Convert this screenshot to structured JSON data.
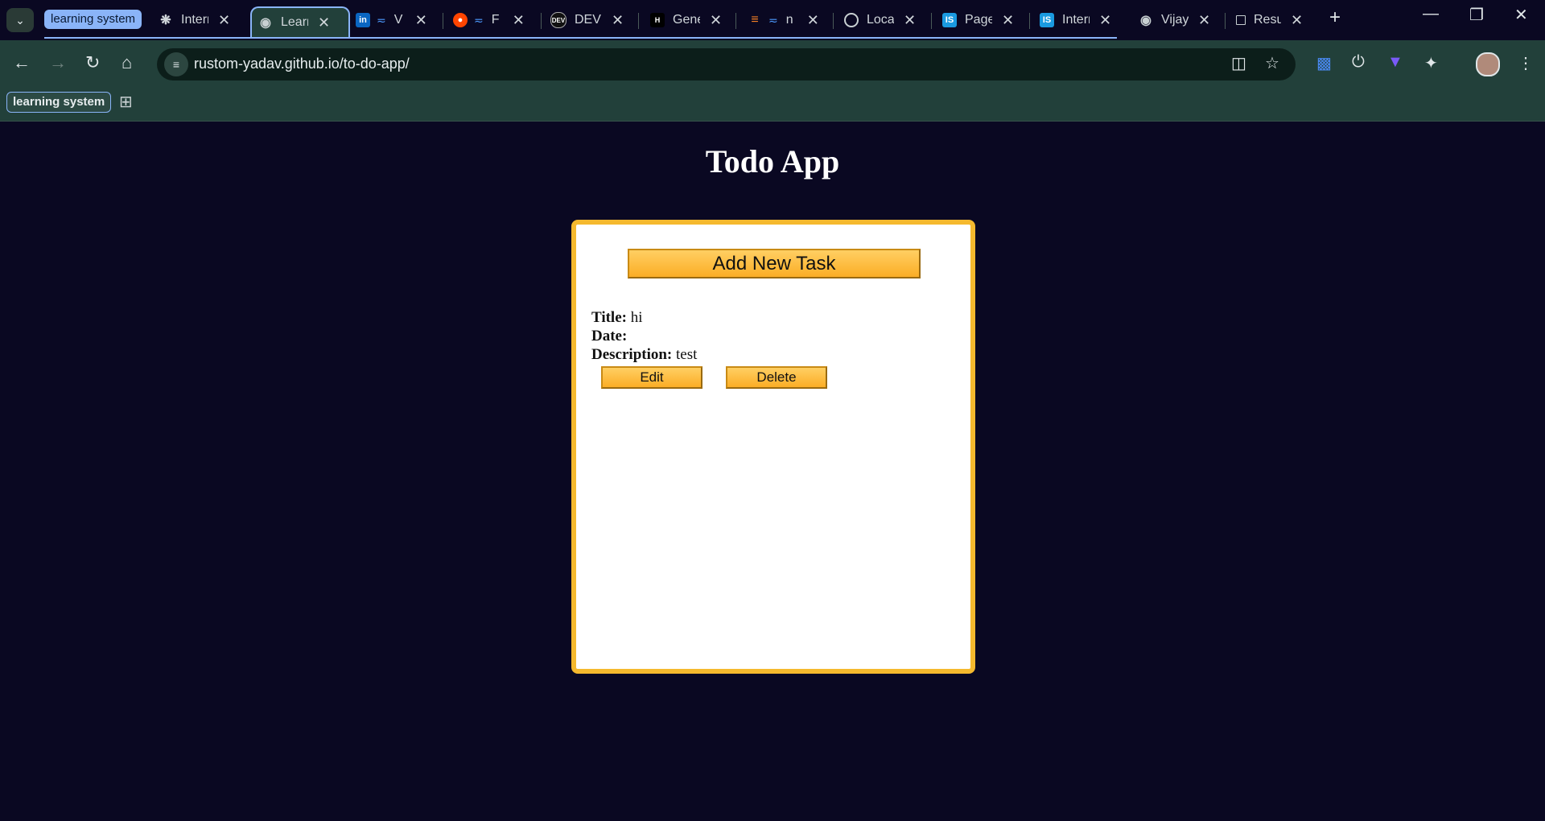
{
  "browser": {
    "tab_group_label": "learning system",
    "tabs": [
      {
        "label": "Interr",
        "icon": "openai-icon",
        "active": false
      },
      {
        "label": "Learn",
        "icon": "globe-icon",
        "active": true
      },
      {
        "label": "V",
        "icon": "linkedin-icon",
        "active": false
      },
      {
        "label": "F",
        "icon": "reddit-icon",
        "active": false
      },
      {
        "label": "DEV",
        "icon": "dev-icon",
        "active": false
      },
      {
        "label": "Gene",
        "icon": "hashnode-icon",
        "active": false
      },
      {
        "label": "n",
        "icon": "stackoverflow-icon",
        "active": false
      },
      {
        "label": "Local",
        "icon": "circle-icon",
        "active": false
      },
      {
        "label": "Page",
        "icon": "is-icon",
        "active": false
      },
      {
        "label": "Interr",
        "icon": "is-icon",
        "active": false
      },
      {
        "label": "Vijay",
        "icon": "globe-icon",
        "active": false
      },
      {
        "label": "Resu",
        "icon": "square-icon",
        "active": false
      }
    ],
    "url": "rustom-yadav.github.io/to-do-app/",
    "bookmark_chip": "learning system"
  },
  "app": {
    "title": "Todo App",
    "add_button": "Add New Task",
    "task": {
      "title_label": "Title:",
      "title_value": "hi",
      "date_label": "Date:",
      "date_value": "",
      "description_label": "Description:",
      "description_value": "test",
      "edit_button": "Edit",
      "delete_button": "Delete"
    }
  },
  "colors": {
    "page_bg": "#0a0822",
    "card_border": "#f5b92e",
    "button": "#fbad25",
    "toolbar": "#22403a",
    "group_accent": "#8ab4f8"
  }
}
